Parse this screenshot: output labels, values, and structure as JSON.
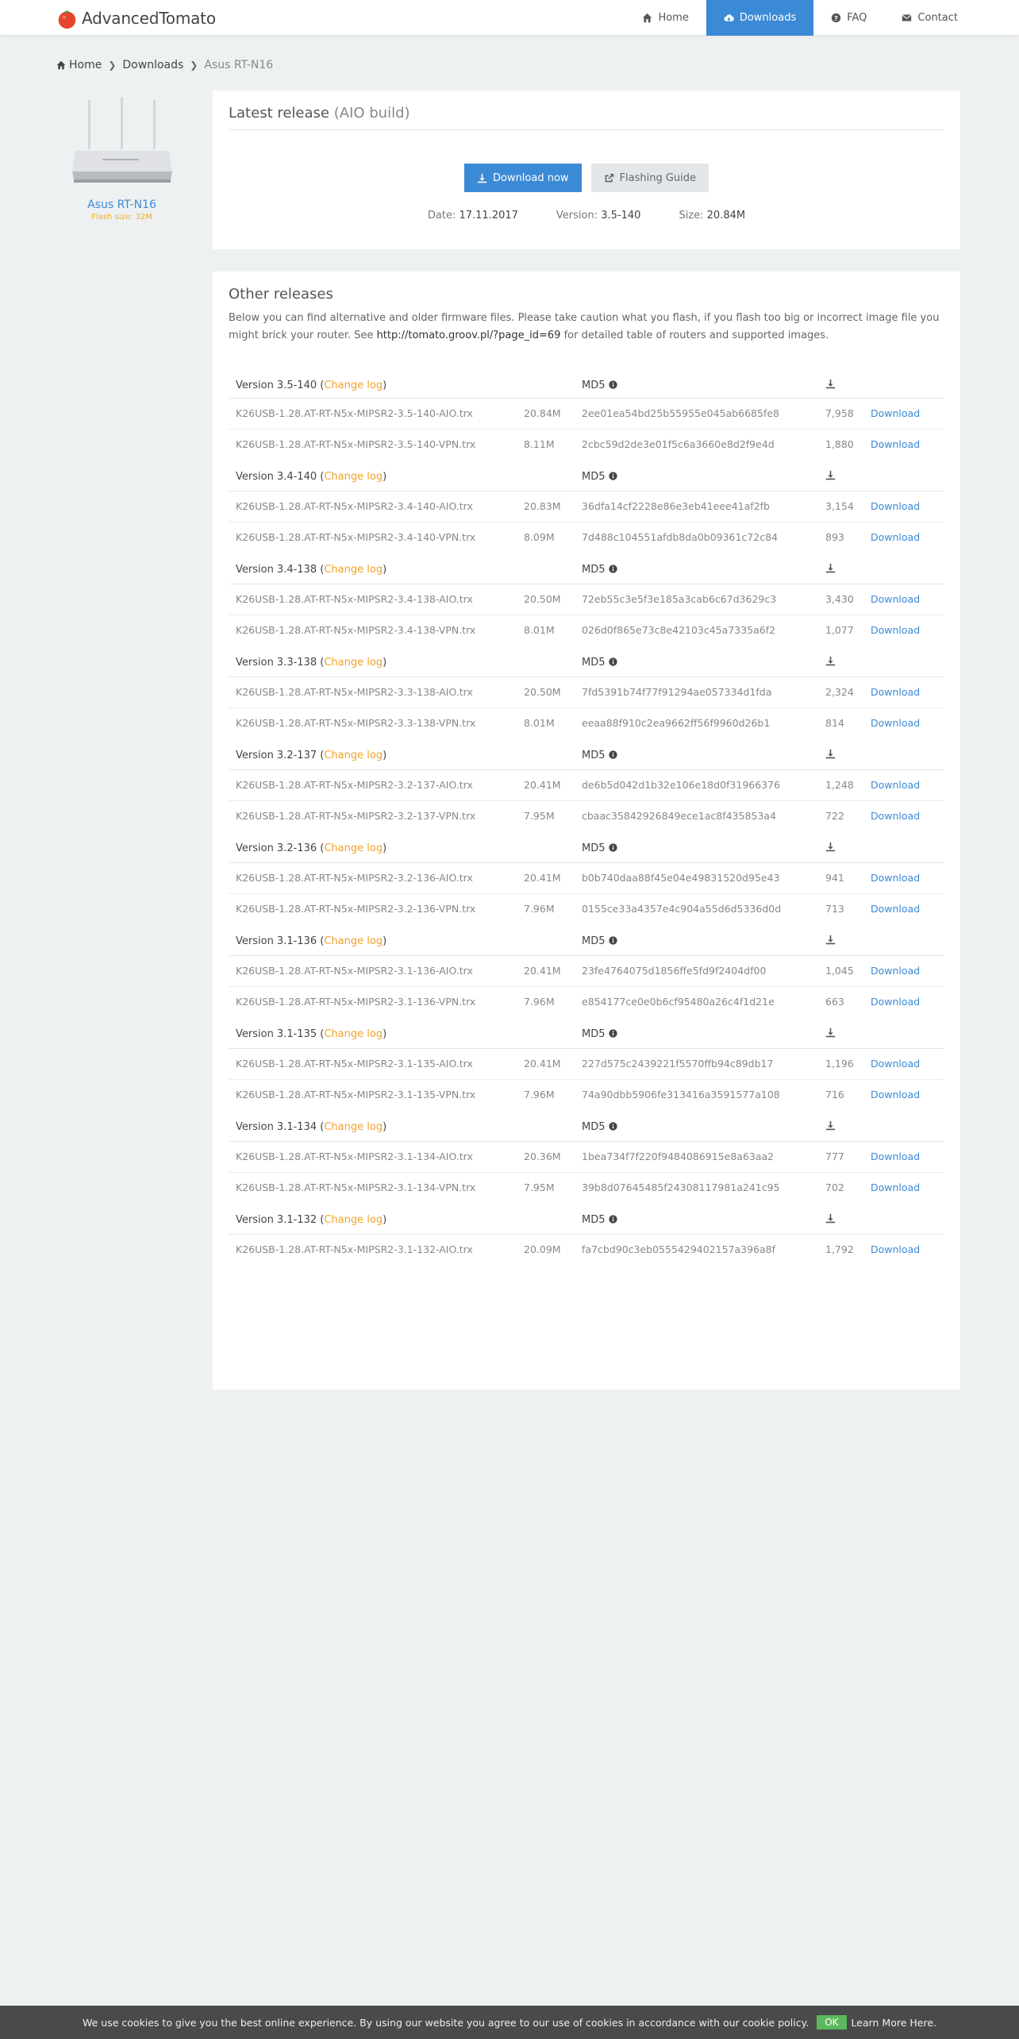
{
  "brand": {
    "name": "AdvancedTomato",
    "logo_icon": "tomato-icon",
    "accent": "#3b8ad6"
  },
  "nav": [
    {
      "label": "Home",
      "icon": "home-icon",
      "active": false
    },
    {
      "label": "Downloads",
      "icon": "cloud-download-icon",
      "active": true
    },
    {
      "label": "FAQ",
      "icon": "question-circle-icon",
      "active": false
    },
    {
      "label": "Contact",
      "icon": "envelope-icon",
      "active": false
    }
  ],
  "breadcrumb": [
    "Home",
    "Downloads",
    "Asus RT-N16"
  ],
  "product": {
    "name": "Asus RT-N16",
    "flash_size": "Flash size: 32M"
  },
  "latest": {
    "title": "Latest release",
    "title_suffix": "(AIO build)",
    "download_label": "Download now",
    "guide_label": "Flashing Guide",
    "date_label": "Date:",
    "date": "17.11.2017",
    "version_label": "Version:",
    "version": "3.5-140",
    "size_label": "Size:",
    "size": "20.84M"
  },
  "other": {
    "title": "Other releases",
    "intro_before": "Below you can find alternative and older firmware files. Please take caution what you flash, if you flash too big or incorrect image file you might brick your router. See ",
    "intro_link": "http://tomato.groov.pl/?page_id=69",
    "intro_after": " for detailed table of routers and supported images.",
    "md5_header": "MD5",
    "changelog_label": "Change log",
    "download_label": "Download",
    "versions": [
      {
        "version": "Version 3.5-140",
        "files": [
          {
            "name": "K26USB-1.28.AT-RT-N5x-MIPSR2-3.5-140-AIO.trx",
            "size": "20.84M",
            "md5": "2ee01ea54bd25b55955e045ab6685fe8",
            "count": "7,958"
          },
          {
            "name": "K26USB-1.28.AT-RT-N5x-MIPSR2-3.5-140-VPN.trx",
            "size": "8.11M",
            "md5": "2cbc59d2de3e01f5c6a3660e8d2f9e4d",
            "count": "1,880"
          }
        ]
      },
      {
        "version": "Version 3.4-140",
        "files": [
          {
            "name": "K26USB-1.28.AT-RT-N5x-MIPSR2-3.4-140-AIO.trx",
            "size": "20.83M",
            "md5": "36dfa14cf2228e86e3eb41eee41af2fb",
            "count": "3,154"
          },
          {
            "name": "K26USB-1.28.AT-RT-N5x-MIPSR2-3.4-140-VPN.trx",
            "size": "8.09M",
            "md5": "7d488c104551afdb8da0b09361c72c84",
            "count": "893"
          }
        ]
      },
      {
        "version": "Version 3.4-138",
        "files": [
          {
            "name": "K26USB-1.28.AT-RT-N5x-MIPSR2-3.4-138-AIO.trx",
            "size": "20.50M",
            "md5": "72eb55c3e5f3e185a3cab6c67d3629c3",
            "count": "3,430"
          },
          {
            "name": "K26USB-1.28.AT-RT-N5x-MIPSR2-3.4-138-VPN.trx",
            "size": "8.01M",
            "md5": "026d0f865e73c8e42103c45a7335a6f2",
            "count": "1,077"
          }
        ]
      },
      {
        "version": "Version 3.3-138",
        "files": [
          {
            "name": "K26USB-1.28.AT-RT-N5x-MIPSR2-3.3-138-AIO.trx",
            "size": "20.50M",
            "md5": "7fd5391b74f77f91294ae057334d1fda",
            "count": "2,324"
          },
          {
            "name": "K26USB-1.28.AT-RT-N5x-MIPSR2-3.3-138-VPN.trx",
            "size": "8.01M",
            "md5": "eeaa88f910c2ea9662ff56f9960d26b1",
            "count": "814"
          }
        ]
      },
      {
        "version": "Version 3.2-137",
        "files": [
          {
            "name": "K26USB-1.28.AT-RT-N5x-MIPSR2-3.2-137-AIO.trx",
            "size": "20.41M",
            "md5": "de6b5d042d1b32e106e18d0f31966376",
            "count": "1,248"
          },
          {
            "name": "K26USB-1.28.AT-RT-N5x-MIPSR2-3.2-137-VPN.trx",
            "size": "7.95M",
            "md5": "cbaac35842926849ece1ac8f435853a4",
            "count": "722"
          }
        ]
      },
      {
        "version": "Version 3.2-136",
        "files": [
          {
            "name": "K26USB-1.28.AT-RT-N5x-MIPSR2-3.2-136-AIO.trx",
            "size": "20.41M",
            "md5": "b0b740daa88f45e04e49831520d95e43",
            "count": "941"
          },
          {
            "name": "K26USB-1.28.AT-RT-N5x-MIPSR2-3.2-136-VPN.trx",
            "size": "7.96M",
            "md5": "0155ce33a4357e4c904a55d6d5336d0d",
            "count": "713"
          }
        ]
      },
      {
        "version": "Version 3.1-136",
        "files": [
          {
            "name": "K26USB-1.28.AT-RT-N5x-MIPSR2-3.1-136-AIO.trx",
            "size": "20.41M",
            "md5": "23fe4764075d1856ffe5fd9f2404df00",
            "count": "1,045"
          },
          {
            "name": "K26USB-1.28.AT-RT-N5x-MIPSR2-3.1-136-VPN.trx",
            "size": "7.96M",
            "md5": "e854177ce0e0b6cf95480a26c4f1d21e",
            "count": "663"
          }
        ]
      },
      {
        "version": "Version 3.1-135",
        "files": [
          {
            "name": "K26USB-1.28.AT-RT-N5x-MIPSR2-3.1-135-AIO.trx",
            "size": "20.41M",
            "md5": "227d575c2439221f5570ffb94c89db17",
            "count": "1,196"
          },
          {
            "name": "K26USB-1.28.AT-RT-N5x-MIPSR2-3.1-135-VPN.trx",
            "size": "7.96M",
            "md5": "74a90dbb5906fe313416a3591577a108",
            "count": "716"
          }
        ]
      },
      {
        "version": "Version 3.1-134",
        "files": [
          {
            "name": "K26USB-1.28.AT-RT-N5x-MIPSR2-3.1-134-AIO.trx",
            "size": "20.36M",
            "md5": "1bea734f7f220f9484086915e8a63aa2",
            "count": "777"
          },
          {
            "name": "K26USB-1.28.AT-RT-N5x-MIPSR2-3.1-134-VPN.trx",
            "size": "7.95M",
            "md5": "39b8d07645485f24308117981a241c95",
            "count": "702"
          }
        ]
      },
      {
        "version": "Version 3.1-132",
        "files": [
          {
            "name": "K26USB-1.28.AT-RT-N5x-MIPSR2-3.1-132-AIO.trx",
            "size": "20.09M",
            "md5": "fa7cbd90c3eb0555429402157a396a8f",
            "count": "1,792"
          }
        ]
      }
    ]
  },
  "cookie": {
    "text": "We use cookies to give you the best online experience. By using our website you agree to our use of cookies in accordance with our cookie policy.",
    "ok": "OK",
    "more": "Learn More Here."
  }
}
